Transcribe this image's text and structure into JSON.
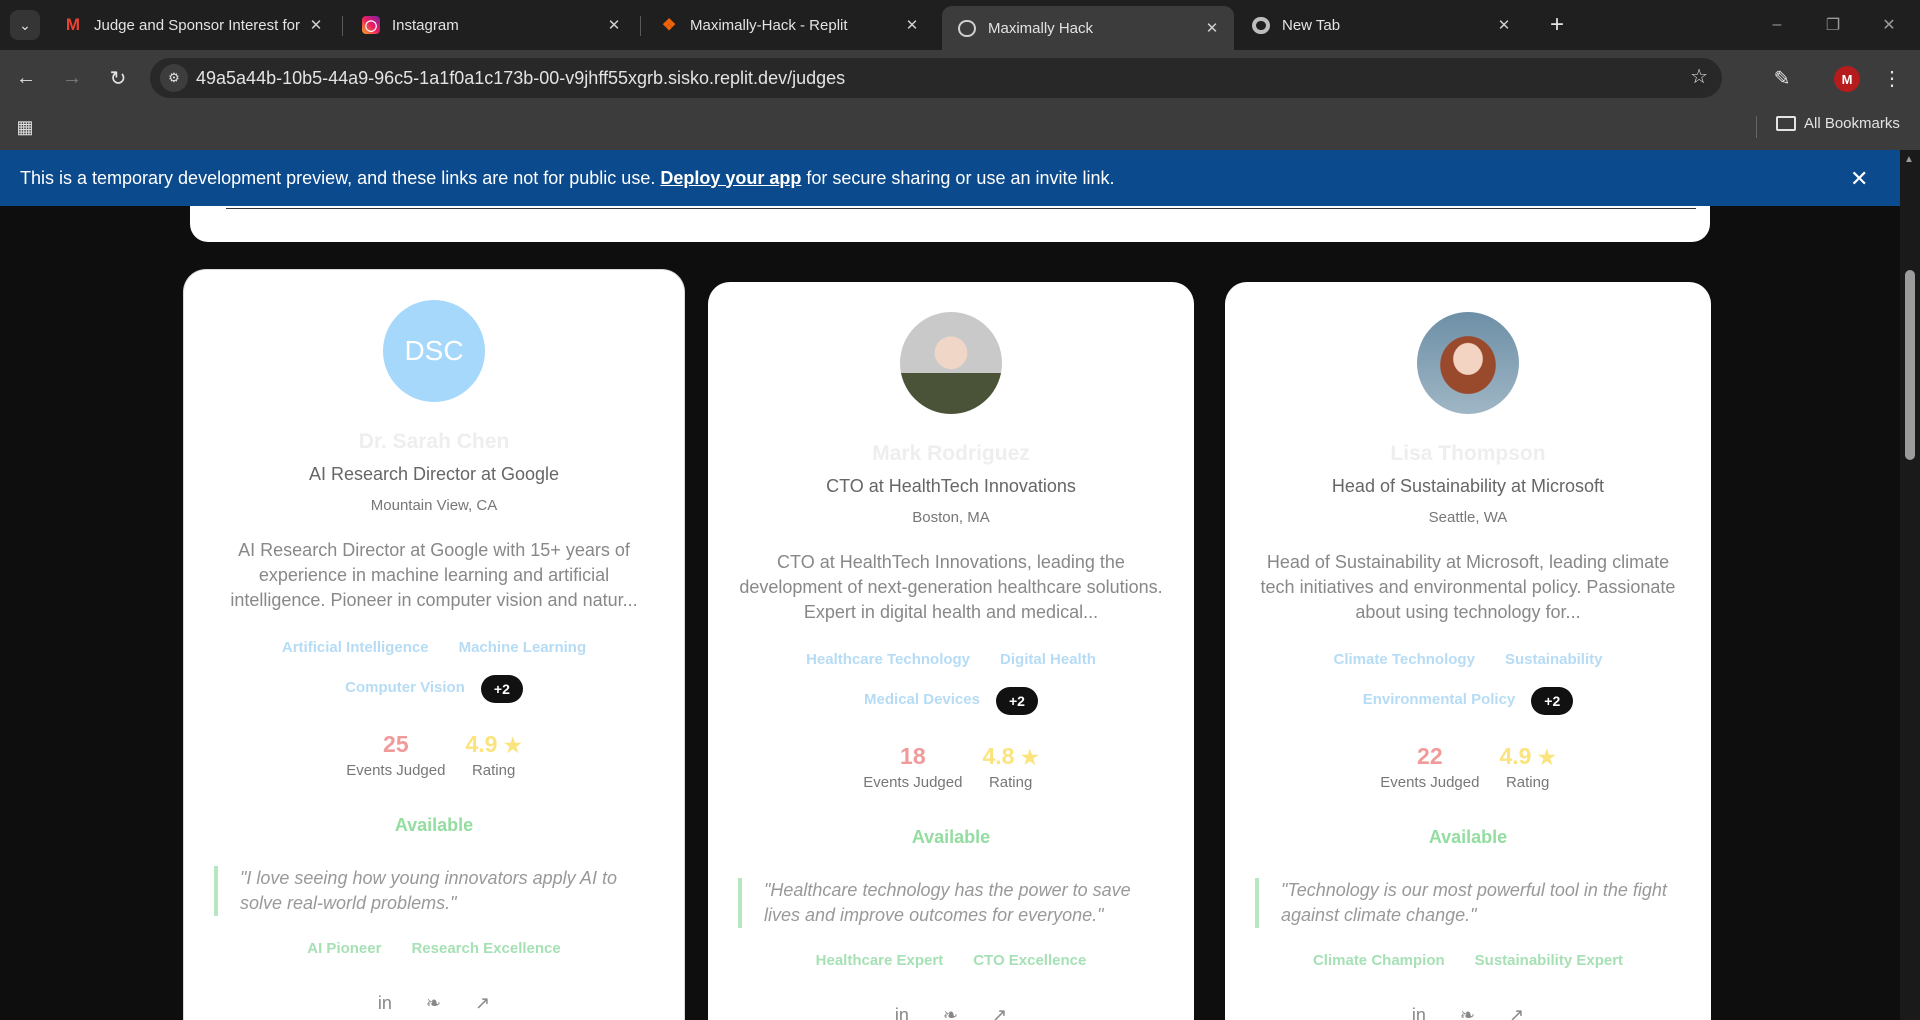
{
  "browser": {
    "tabs": [
      {
        "title": "Judge and Sponsor Interest for",
        "icon": "gmail-icon",
        "active": false
      },
      {
        "title": "Instagram",
        "icon": "instagram-icon",
        "active": false
      },
      {
        "title": "Maximally-Hack - Replit",
        "icon": "replit-icon",
        "active": false
      },
      {
        "title": "Maximally Hack",
        "icon": "globe-icon",
        "active": true
      },
      {
        "title": "New Tab",
        "icon": "chrome-icon",
        "active": false
      }
    ],
    "url": "49a5a44b-10b5-44a9-96c5-1a1f0a1c173b-00-v9jhff55xgrb.sisko.replit.dev/judges",
    "profile_initial": "M",
    "all_bookmarks": "All Bookmarks"
  },
  "banner": {
    "text_before": "This is a temporary development preview, and these links are not for public use.",
    "link": "Deploy your app",
    "text_after": "for secure sharing or use an invite link."
  },
  "judges": [
    {
      "initials": "DSC",
      "name": "Dr. Sarah Chen",
      "role": "AI Research Director at Google",
      "location": "Mountain View, CA",
      "bio": "AI Research Director at Google with 15+ years of experience in machine learning and artificial intelligence. Pioneer in computer vision and natur...",
      "tags": [
        "Artificial Intelligence",
        "Machine Learning",
        "Computer Vision"
      ],
      "more": "+2",
      "events_judged": "25",
      "events_label": "Events Judged",
      "rating": "4.9",
      "rating_label": "Rating",
      "availability": "Available",
      "quote": "\"I love seeing how young innovators apply AI to solve real-world problems.\"",
      "badges": [
        "AI Pioneer",
        "Research Excellence"
      ]
    },
    {
      "name": "Mark Rodriguez",
      "role": "CTO at HealthTech Innovations",
      "location": "Boston, MA",
      "bio": "CTO at HealthTech Innovations, leading the development of next-generation healthcare solutions. Expert in digital health and medical...",
      "tags": [
        "Healthcare Technology",
        "Digital Health",
        "Medical Devices"
      ],
      "more": "+2",
      "events_judged": "18",
      "events_label": "Events Judged",
      "rating": "4.8",
      "rating_label": "Rating",
      "availability": "Available",
      "quote": "\"Healthcare technology has the power to save lives and improve outcomes for everyone.\"",
      "badges": [
        "Healthcare Expert",
        "CTO Excellence"
      ]
    },
    {
      "name": "Lisa Thompson",
      "role": "Head of Sustainability at Microsoft",
      "location": "Seattle, WA",
      "bio": "Head of Sustainability at Microsoft, leading climate tech initiatives and environmental policy. Passionate about using technology for...",
      "tags": [
        "Climate Technology",
        "Sustainability",
        "Environmental Policy"
      ],
      "more": "+2",
      "events_judged": "22",
      "events_label": "Events Judged",
      "rating": "4.9",
      "rating_label": "Rating",
      "availability": "Available",
      "quote": "\"Technology is our most powerful tool in the fight against climate change.\"",
      "badges": [
        "Climate Champion",
        "Sustainability Expert"
      ]
    }
  ],
  "colors": {
    "banner": "#0b4a8c",
    "events": "#f09a9a",
    "rating": "#fbe37e",
    "available": "#93dda0",
    "tag": "#b6dcf5"
  }
}
